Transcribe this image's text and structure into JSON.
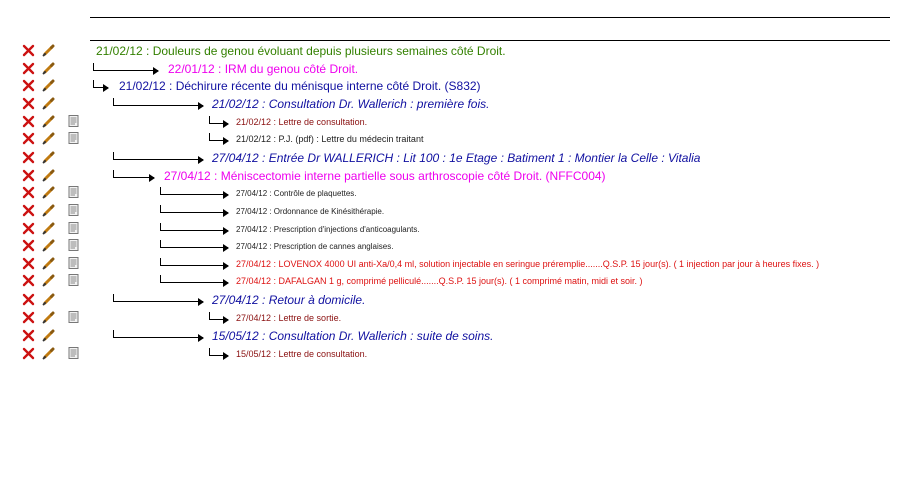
{
  "rows": [
    {
      "text": "21/02/12 : Douleurs de genou évoluant depuis plusieurs semaines côté Droit."
    },
    {
      "text": "22/01/12 : IRM du genou côté Droit."
    },
    {
      "text": "21/02/12 : Déchirure récente du ménisque interne côté Droit. (S832)"
    },
    {
      "text": "21/02/12 : Consultation Dr. Wallerich : première fois."
    },
    {
      "text": "21/02/12 : Lettre de consultation."
    },
    {
      "text": "21/02/12 : P.J. (pdf) : Lettre du médecin traitant"
    },
    {
      "text": "27/04/12 : Entrée Dr WALLERICH : Lit 100 : 1e Etage : Batiment 1 : Montier la Celle : Vitalia"
    },
    {
      "text": "27/04/12 : Méniscectomie interne partielle sous arthroscopie côté Droit. (NFFC004)"
    },
    {
      "text": "27/04/12 : Contrôle de plaquettes."
    },
    {
      "text": "27/04/12 : Ordonnance de Kinésithérapie."
    },
    {
      "text": "27/04/12 : Prescription d'injections d'anticoagulants."
    },
    {
      "text": "27/04/12 : Prescription de cannes anglaises."
    },
    {
      "text": "27/04/12 : LOVENOX 4000 UI anti-Xa/0,4 ml, solution injectable en seringue préremplie.......Q.S.P. 15 jour(s). ( 1 injection par jour à heures fixes. )"
    },
    {
      "text": "27/04/12 : DAFALGAN 1 g, comprimé pelliculé.......Q.S.P. 15 jour(s). ( 1 comprimé matin, midi et soir. )"
    },
    {
      "text": "27/04/12 : Retour à domicile."
    },
    {
      "text": "27/04/12 : Lettre de sortie."
    },
    {
      "text": "15/05/12 : Consultation Dr. Wallerich : suite de soins."
    },
    {
      "text": "15/05/12 : Lettre de consultation."
    }
  ],
  "icons": {
    "delete": "delete-icon",
    "edit": "pencil-icon",
    "document": "document-icon"
  },
  "colors": {
    "green": "#338000",
    "magenta": "#ee00ee",
    "blue": "#1010a0",
    "red": "#dd1111",
    "maroon": "#8a1010"
  }
}
